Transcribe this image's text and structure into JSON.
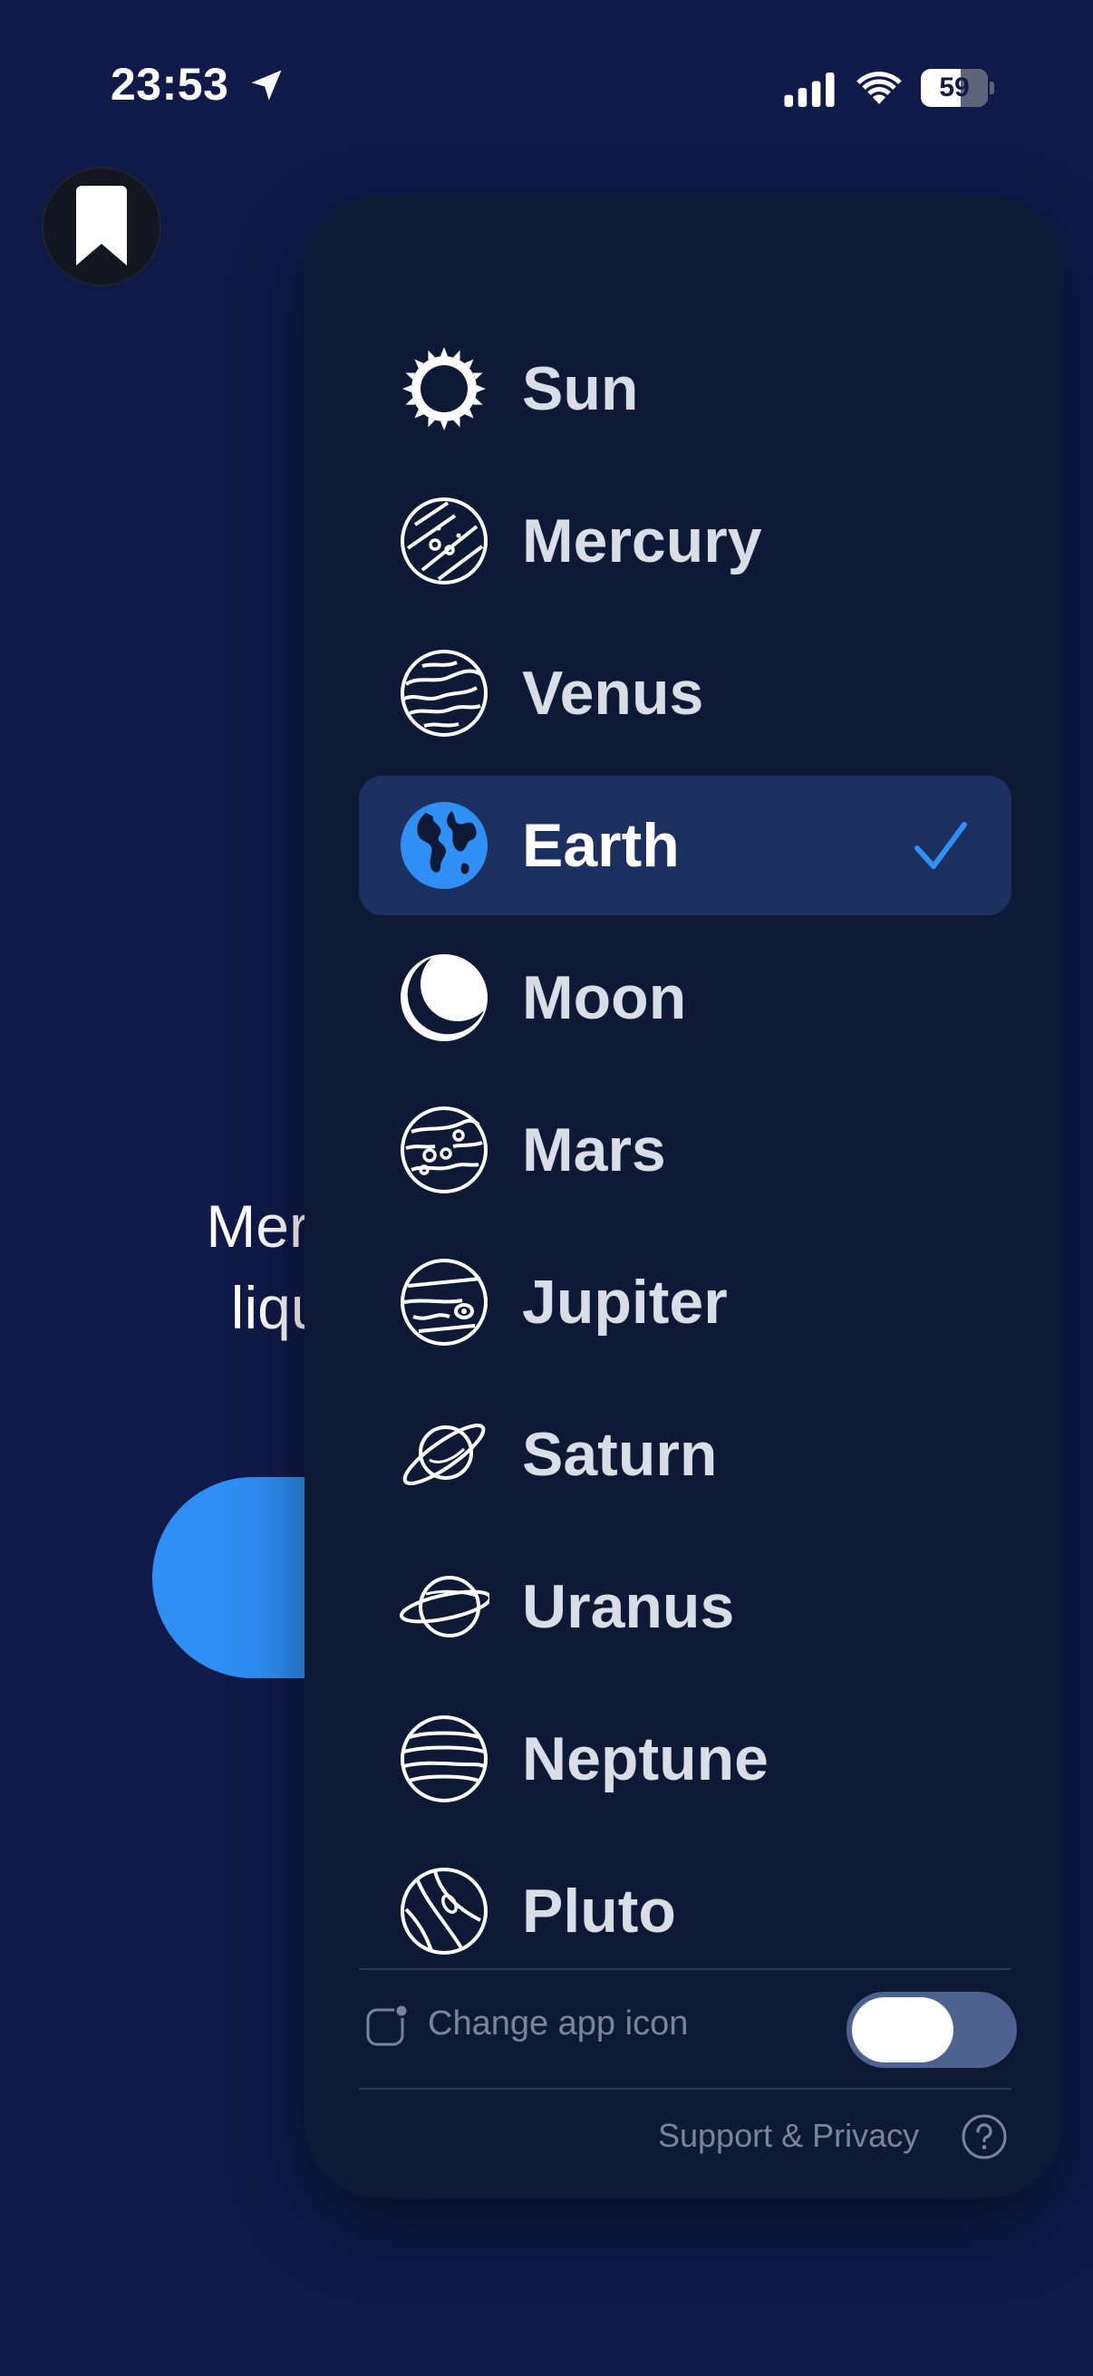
{
  "status_bar": {
    "time": "23:53",
    "battery_level": "59",
    "battery_fraction": 0.59
  },
  "background": {
    "text_line_1": "Mercur",
    "text_line_2": "liquic",
    "button_color": "#2f8ff5"
  },
  "menu": {
    "selected": "Earth",
    "accent_color": "#2f8ff5",
    "items": [
      {
        "label": "Sun",
        "icon": "sun-icon"
      },
      {
        "label": "Mercury",
        "icon": "mercury-icon"
      },
      {
        "label": "Venus",
        "icon": "venus-icon"
      },
      {
        "label": "Earth",
        "icon": "earth-icon"
      },
      {
        "label": "Moon",
        "icon": "moon-icon"
      },
      {
        "label": "Mars",
        "icon": "mars-icon"
      },
      {
        "label": "Jupiter",
        "icon": "jupiter-icon"
      },
      {
        "label": "Saturn",
        "icon": "saturn-icon"
      },
      {
        "label": "Uranus",
        "icon": "uranus-icon"
      },
      {
        "label": "Neptune",
        "icon": "neptune-icon"
      },
      {
        "label": "Pluto",
        "icon": "pluto-icon"
      }
    ]
  },
  "footer": {
    "change_app_icon_label": "Change app icon",
    "change_app_icon_enabled": true,
    "support_label": "Support & Privacy"
  }
}
